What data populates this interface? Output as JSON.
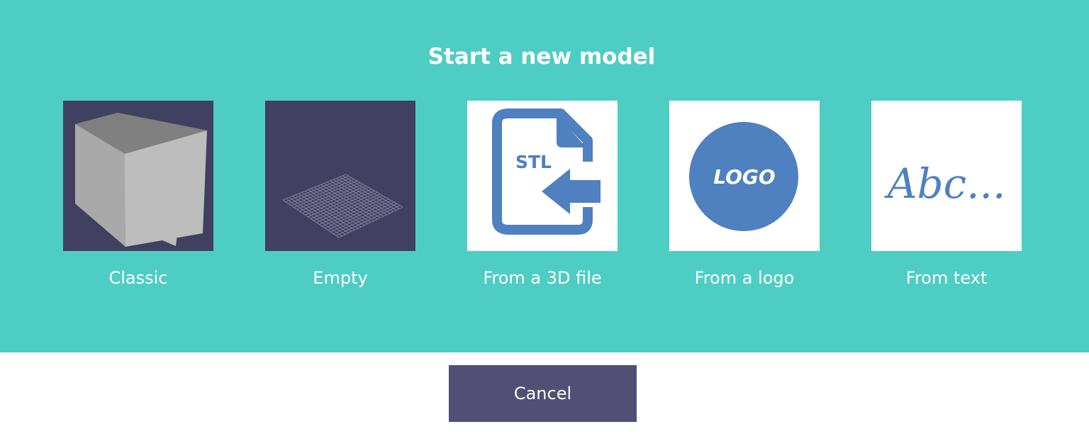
{
  "dialog": {
    "title": "Start a new model",
    "cancel_label": "Cancel"
  },
  "options": [
    {
      "label": "Classic",
      "icon": "cube-icon"
    },
    {
      "label": "Empty",
      "icon": "grid-plane-icon"
    },
    {
      "label": "From a 3D file",
      "icon": "stl-file-import-icon",
      "icon_text": "STL"
    },
    {
      "label": "From a logo",
      "icon": "logo-circle-icon",
      "icon_text": "LOGO"
    },
    {
      "label": "From text",
      "icon": "text-script-icon",
      "icon_text": "Abc..."
    }
  ],
  "colors": {
    "panel_bg": "#4ecdc4",
    "dark_thumb_bg": "#424060",
    "icon_blue": "#4f80c0",
    "cancel_bg": "#514f75"
  }
}
